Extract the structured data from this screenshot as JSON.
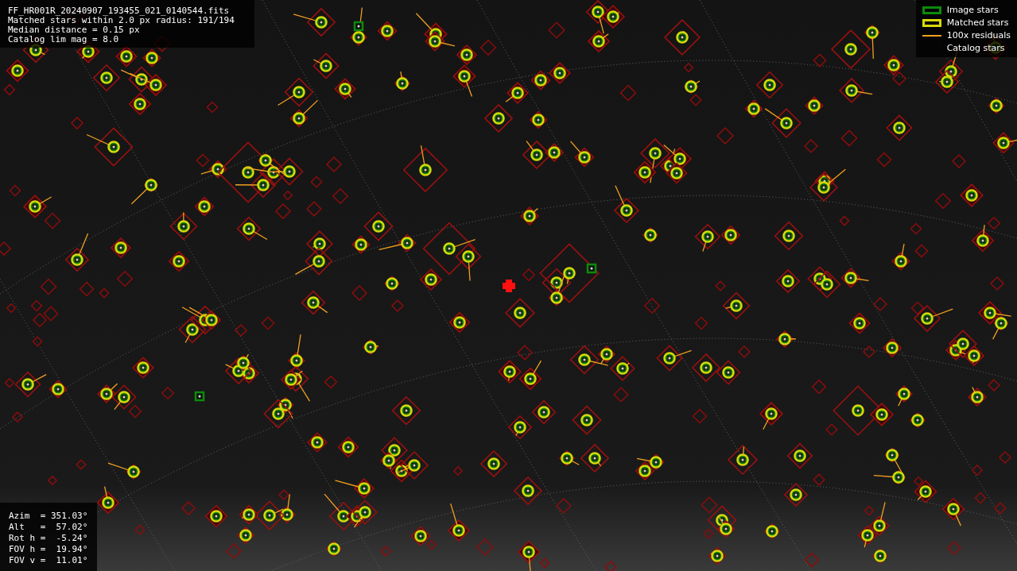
{
  "info_lines": [
    "FF_HR001R_20240907_193455_021_0140544.fits",
    "Matched stars within 2.0 px radius: 191/194",
    "Median distance = 0.15 px",
    "Catalog lim mag = 8.0"
  ],
  "legend": [
    {
      "kind": "image",
      "label": "Image stars"
    },
    {
      "kind": "matched",
      "label": "Matched stars"
    },
    {
      "kind": "residual",
      "label": "100x residuals"
    },
    {
      "kind": "catalog",
      "label": "Catalog stars"
    }
  ],
  "pointing_lines": [
    "Azim  = 351.03°",
    "Alt   =  57.02°",
    "Rot h =  -5.24°",
    "FOV h =  19.94°",
    "FOV v =  11.01°"
  ]
}
